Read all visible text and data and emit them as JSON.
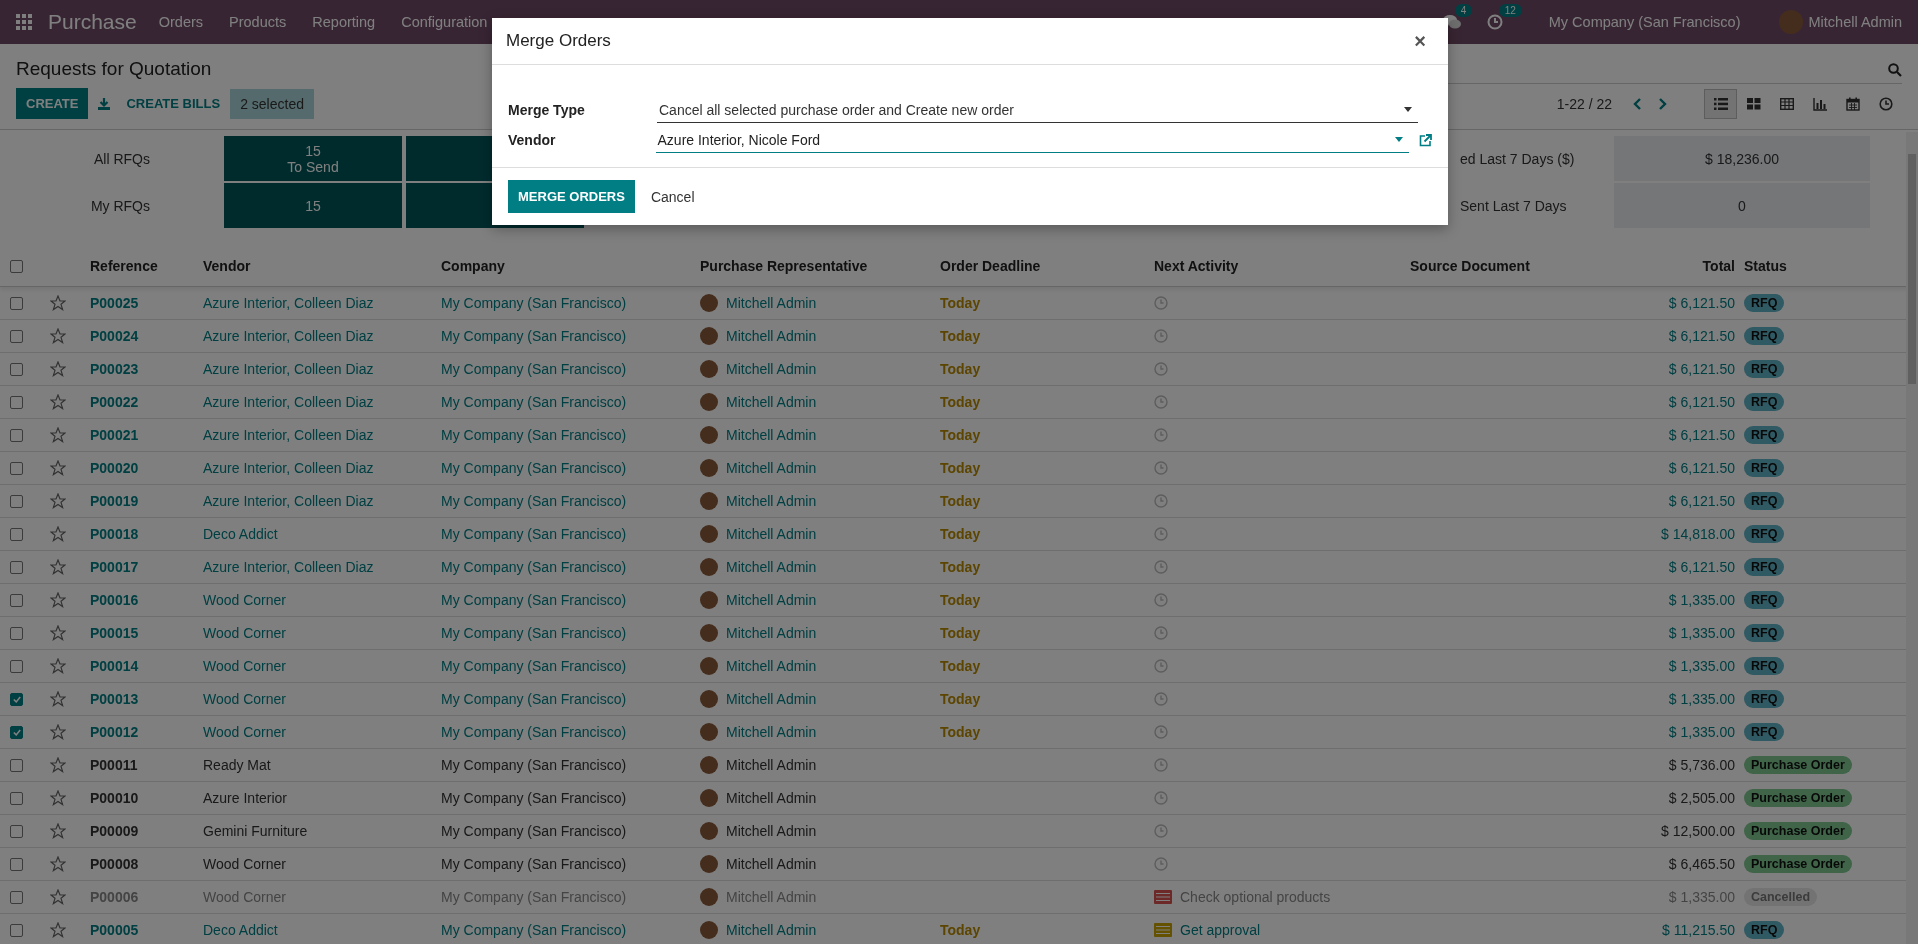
{
  "topbar": {
    "app": "Purchase",
    "menu": [
      "Orders",
      "Products",
      "Reporting",
      "Configuration"
    ],
    "messages_badge": "4",
    "activities_badge": "12",
    "company": "My Company (San Francisco)",
    "user": "Mitchell Admin"
  },
  "control_panel": {
    "title": "Requests for Quotation",
    "buttons": [
      "CREATE",
      "CREATE BILLS"
    ],
    "selection": "2 selected",
    "pager": "1-22 / 22",
    "views": [
      {
        "kind": "list",
        "selected": true
      },
      {
        "kind": "kanban",
        "selected": false
      },
      {
        "kind": "pivot",
        "selected": false
      },
      {
        "kind": "graph",
        "selected": false
      },
      {
        "kind": "calendar",
        "selected": false
      },
      {
        "kind": "activity",
        "selected": false
      }
    ]
  },
  "stats": {
    "rows": [
      {
        "label": "All RFQs",
        "tile": {
          "value": "15",
          "caption": "To Send"
        },
        "right_label": "ed Last 7 Days ($)",
        "right_value": "$ 18,236.00"
      },
      {
        "label": "My RFQs",
        "tile": {
          "value": "15"
        },
        "right_label": "Sent Last 7 Days",
        "right_value": "0"
      }
    ]
  },
  "table": {
    "all_selected": false,
    "columns": [
      "Reference",
      "Vendor",
      "Company",
      "Purchase Representative",
      "Order Deadline",
      "Next Activity",
      "Source Document",
      "Total",
      "Status"
    ],
    "rows": [
      {
        "checked": false,
        "reference": "P00025",
        "vendor": "Azure Interior, Colleen Diaz",
        "company": "My Company (San Francisco)",
        "representative": "Mitchell Admin",
        "deadline": "Today",
        "activity": {
          "kind": "none"
        },
        "total": "$ 6,121.50",
        "status": {
          "kind": "rfq",
          "label": "RFQ"
        }
      },
      {
        "checked": false,
        "reference": "P00024",
        "vendor": "Azure Interior, Colleen Diaz",
        "company": "My Company (San Francisco)",
        "representative": "Mitchell Admin",
        "deadline": "Today",
        "activity": {
          "kind": "none"
        },
        "total": "$ 6,121.50",
        "status": {
          "kind": "rfq",
          "label": "RFQ"
        }
      },
      {
        "checked": false,
        "reference": "P00023",
        "vendor": "Azure Interior, Colleen Diaz",
        "company": "My Company (San Francisco)",
        "representative": "Mitchell Admin",
        "deadline": "Today",
        "activity": {
          "kind": "none"
        },
        "total": "$ 6,121.50",
        "status": {
          "kind": "rfq",
          "label": "RFQ"
        }
      },
      {
        "checked": false,
        "reference": "P00022",
        "vendor": "Azure Interior, Colleen Diaz",
        "company": "My Company (San Francisco)",
        "representative": "Mitchell Admin",
        "deadline": "Today",
        "activity": {
          "kind": "none"
        },
        "total": "$ 6,121.50",
        "status": {
          "kind": "rfq",
          "label": "RFQ"
        }
      },
      {
        "checked": false,
        "reference": "P00021",
        "vendor": "Azure Interior, Colleen Diaz",
        "company": "My Company (San Francisco)",
        "representative": "Mitchell Admin",
        "deadline": "Today",
        "activity": {
          "kind": "none"
        },
        "total": "$ 6,121.50",
        "status": {
          "kind": "rfq",
          "label": "RFQ"
        }
      },
      {
        "checked": false,
        "reference": "P00020",
        "vendor": "Azure Interior, Colleen Diaz",
        "company": "My Company (San Francisco)",
        "representative": "Mitchell Admin",
        "deadline": "Today",
        "activity": {
          "kind": "none"
        },
        "total": "$ 6,121.50",
        "status": {
          "kind": "rfq",
          "label": "RFQ"
        }
      },
      {
        "checked": false,
        "reference": "P00019",
        "vendor": "Azure Interior, Colleen Diaz",
        "company": "My Company (San Francisco)",
        "representative": "Mitchell Admin",
        "deadline": "Today",
        "activity": {
          "kind": "none"
        },
        "total": "$ 6,121.50",
        "status": {
          "kind": "rfq",
          "label": "RFQ"
        }
      },
      {
        "checked": false,
        "reference": "P00018",
        "vendor": "Deco Addict",
        "company": "My Company (San Francisco)",
        "representative": "Mitchell Admin",
        "deadline": "Today",
        "activity": {
          "kind": "none"
        },
        "total": "$ 14,818.00",
        "status": {
          "kind": "rfq",
          "label": "RFQ"
        }
      },
      {
        "checked": false,
        "reference": "P00017",
        "vendor": "Azure Interior, Colleen Diaz",
        "company": "My Company (San Francisco)",
        "representative": "Mitchell Admin",
        "deadline": "Today",
        "activity": {
          "kind": "none"
        },
        "total": "$ 6,121.50",
        "status": {
          "kind": "rfq",
          "label": "RFQ"
        }
      },
      {
        "checked": false,
        "reference": "P00016",
        "vendor": "Wood Corner",
        "company": "My Company (San Francisco)",
        "representative": "Mitchell Admin",
        "deadline": "Today",
        "activity": {
          "kind": "none"
        },
        "total": "$ 1,335.00",
        "status": {
          "kind": "rfq",
          "label": "RFQ"
        }
      },
      {
        "checked": false,
        "reference": "P00015",
        "vendor": "Wood Corner",
        "company": "My Company (San Francisco)",
        "representative": "Mitchell Admin",
        "deadline": "Today",
        "activity": {
          "kind": "none"
        },
        "total": "$ 1,335.00",
        "status": {
          "kind": "rfq",
          "label": "RFQ"
        }
      },
      {
        "checked": false,
        "reference": "P00014",
        "vendor": "Wood Corner",
        "company": "My Company (San Francisco)",
        "representative": "Mitchell Admin",
        "deadline": "Today",
        "activity": {
          "kind": "none"
        },
        "total": "$ 1,335.00",
        "status": {
          "kind": "rfq",
          "label": "RFQ"
        }
      },
      {
        "checked": true,
        "reference": "P00013",
        "vendor": "Wood Corner",
        "company": "My Company (San Francisco)",
        "representative": "Mitchell Admin",
        "deadline": "Today",
        "activity": {
          "kind": "none"
        },
        "total": "$ 1,335.00",
        "status": {
          "kind": "rfq",
          "label": "RFQ"
        }
      },
      {
        "checked": true,
        "reference": "P00012",
        "vendor": "Wood Corner",
        "company": "My Company (San Francisco)",
        "representative": "Mitchell Admin",
        "deadline": "Today",
        "activity": {
          "kind": "none"
        },
        "total": "$ 1,335.00",
        "status": {
          "kind": "rfq",
          "label": "RFQ"
        }
      },
      {
        "checked": false,
        "reference": "P00011",
        "vendor": "Ready Mat",
        "company": "My Company (San Francisco)",
        "representative": "Mitchell Admin",
        "activity": {
          "kind": "none"
        },
        "total": "$ 5,736.00",
        "status": {
          "kind": "order",
          "label": "Purchase Order"
        }
      },
      {
        "checked": false,
        "reference": "P00010",
        "vendor": "Azure Interior",
        "company": "My Company (San Francisco)",
        "representative": "Mitchell Admin",
        "activity": {
          "kind": "none"
        },
        "total": "$ 2,505.00",
        "status": {
          "kind": "order",
          "label": "Purchase Order"
        }
      },
      {
        "checked": false,
        "reference": "P00009",
        "vendor": "Gemini Furniture",
        "company": "My Company (San Francisco)",
        "representative": "Mitchell Admin",
        "activity": {
          "kind": "none"
        },
        "total": "$ 12,500.00",
        "status": {
          "kind": "order",
          "label": "Purchase Order"
        }
      },
      {
        "checked": false,
        "reference": "P00008",
        "vendor": "Wood Corner",
        "company": "My Company (San Francisco)",
        "representative": "Mitchell Admin",
        "activity": {
          "kind": "none"
        },
        "total": "$ 6,465.50",
        "status": {
          "kind": "order",
          "label": "Purchase Order"
        }
      },
      {
        "checked": false,
        "reference": "P00006",
        "vendor": "Wood Corner",
        "company": "My Company (San Francisco)",
        "representative": "Mitchell Admin",
        "activity": {
          "kind": "overdue",
          "label": "Check optional products"
        },
        "total": "$ 1,335.00",
        "status": {
          "kind": "cancelled",
          "label": "Cancelled"
        }
      },
      {
        "checked": false,
        "reference": "P00005",
        "vendor": "Deco Addict",
        "company": "My Company (San Francisco)",
        "representative": "Mitchell Admin",
        "deadline": "Today",
        "activity": {
          "kind": "today",
          "label": "Get approval"
        },
        "total": "$ 11,215.50",
        "status": {
          "kind": "rfq",
          "label": "RFQ"
        }
      }
    ]
  },
  "dialog": {
    "title": "Merge Orders",
    "close": "×",
    "fields": [
      {
        "label": "Merge Type",
        "value": "Cancel all selected purchase order and Create new order",
        "focused": false,
        "external_link": false
      },
      {
        "label": "Vendor",
        "value": "Azure Interior, Nicole Ford",
        "focused": true,
        "external_link": true
      }
    ],
    "buttons": [
      {
        "kind": "primary",
        "label": "MERGE ORDERS"
      },
      {
        "kind": "secondary",
        "label": "Cancel"
      }
    ]
  }
}
